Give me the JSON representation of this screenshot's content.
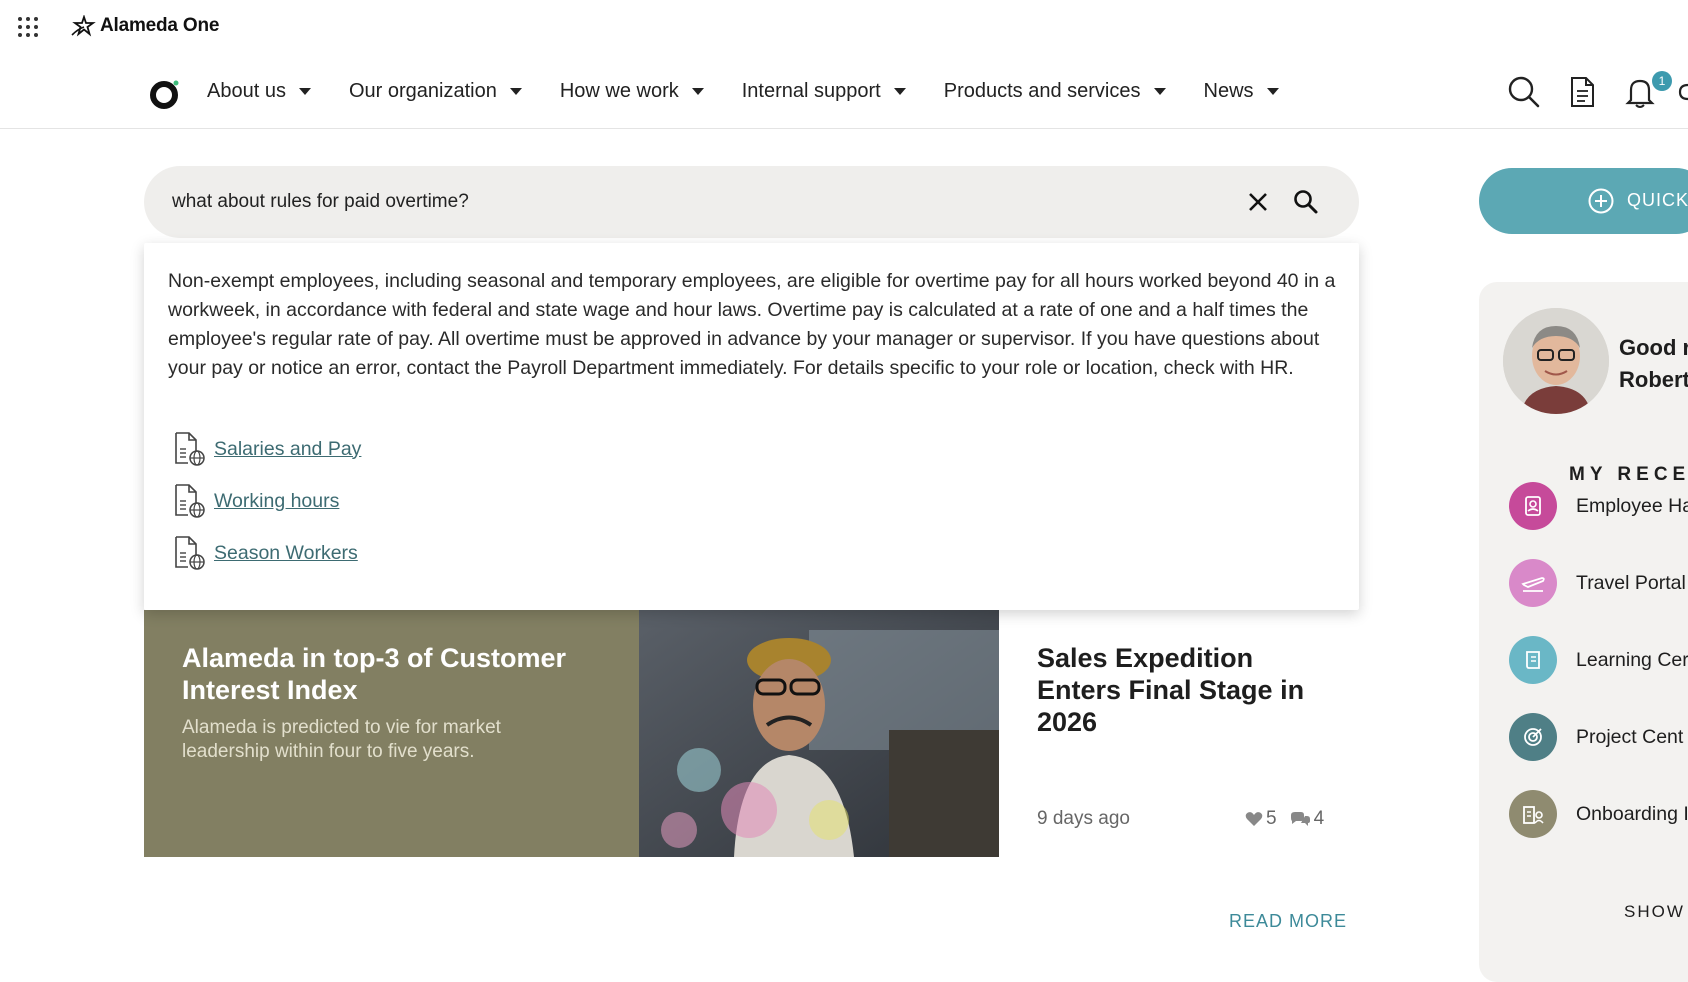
{
  "app": {
    "brand": "Alameda One"
  },
  "nav": {
    "items": [
      {
        "label": "About us"
      },
      {
        "label": "Our organization"
      },
      {
        "label": "How we work"
      },
      {
        "label": "Internal support"
      },
      {
        "label": "Products and services"
      },
      {
        "label": "News"
      }
    ],
    "notification_count": "1"
  },
  "search": {
    "query": "what about rules for paid overtime?",
    "answer": "Non-exempt employees, including seasonal and temporary employees, are eligible for overtime pay for all hours worked beyond 40 in a workweek, in accordance with federal and state wage and hour laws. Overtime pay is calculated at a rate of one and a half times the employee's regular rate of pay. All overtime must be approved in advance by your manager or supervisor. If you have questions about your pay or notice an error, contact the Payroll Department immediately. For details specific to your role or location, check with HR.",
    "sources": [
      {
        "label": "Salaries and Pay"
      },
      {
        "label": "Working hours"
      },
      {
        "label": "Season Workers"
      }
    ]
  },
  "news": {
    "featured": {
      "title": "Alameda in top-3 of Customer Interest Index",
      "subtitle": "Alameda is predicted to vie for market leadership within four to five years."
    },
    "secondary": {
      "title": "Sales Expedition Enters Final Stage in 2026",
      "date": "9 days ago",
      "likes": "5",
      "comments": "4"
    },
    "read_more": "READ MORE"
  },
  "sidebar": {
    "quick_label": "QUICK",
    "greeting_line1": "Good r",
    "greeting_line2": "Robert",
    "recent_title": "MY RECEI",
    "recent_items": [
      {
        "label": "Employee Ha",
        "color": "#c64a9a",
        "icon": "badge-icon"
      },
      {
        "label": "Travel Portal",
        "color": "#d989c9",
        "icon": "plane-icon"
      },
      {
        "label": "Learning Cer",
        "color": "#6ab7c6",
        "icon": "book-icon"
      },
      {
        "label": "Project Cent",
        "color": "#4f7f86",
        "icon": "target-icon"
      },
      {
        "label": "Onboarding I",
        "color": "#8f8b70",
        "icon": "building-icon"
      }
    ],
    "show_more": "SHOW"
  },
  "colors": {
    "accent": "#5ca8b4",
    "olive": "#827f62",
    "link": "#3d6b72"
  }
}
